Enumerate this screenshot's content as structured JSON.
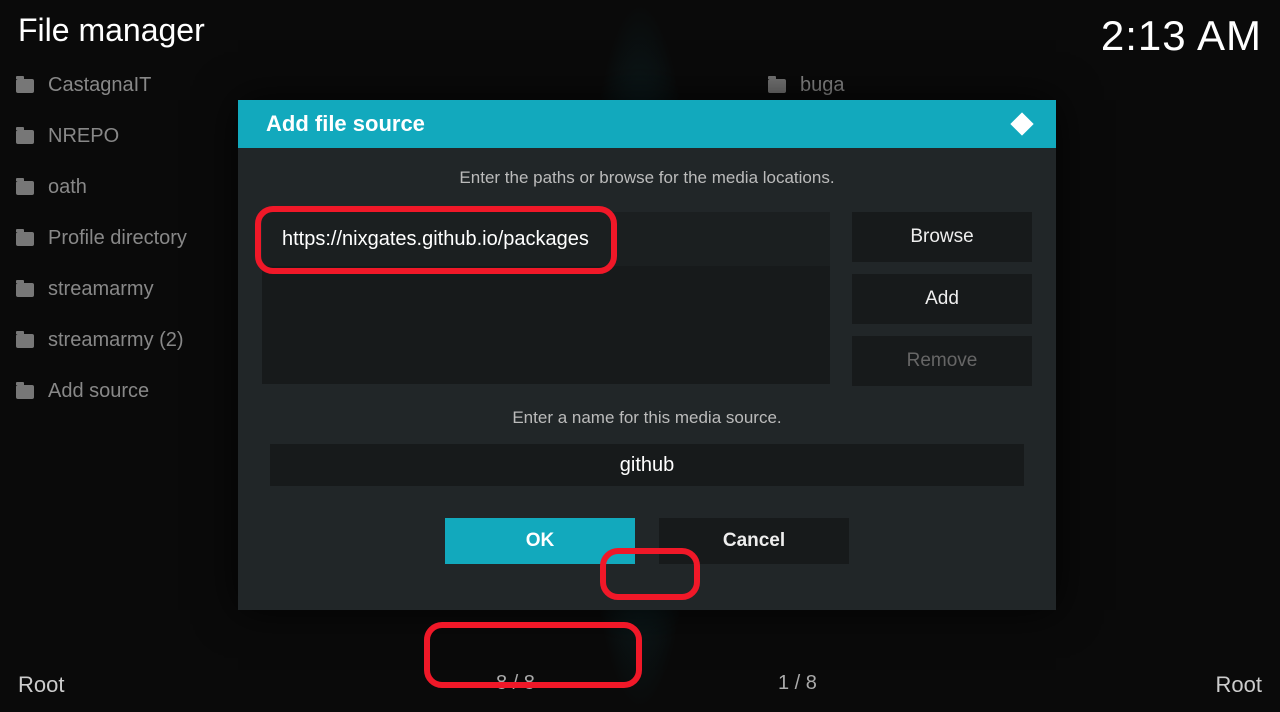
{
  "header": {
    "title": "File manager",
    "clock": "2:13 AM"
  },
  "left_list": [
    "CastagnaIT",
    "NREPO",
    "oath",
    "Profile directory",
    "streamarmy",
    "streamarmy (2)",
    "Add source"
  ],
  "right_list": [
    "buga"
  ],
  "footer": {
    "left": "Root",
    "count_left": "8 / 8",
    "count_right": "1 / 8",
    "right": "Root"
  },
  "dialog": {
    "title": "Add file source",
    "instruction_paths": "Enter the paths or browse for the media locations.",
    "path_value": "https://nixgates.github.io/packages",
    "browse": "Browse",
    "add": "Add",
    "remove": "Remove",
    "instruction_name": "Enter a name for this media source.",
    "name_value": "github",
    "ok": "OK",
    "cancel": "Cancel"
  }
}
